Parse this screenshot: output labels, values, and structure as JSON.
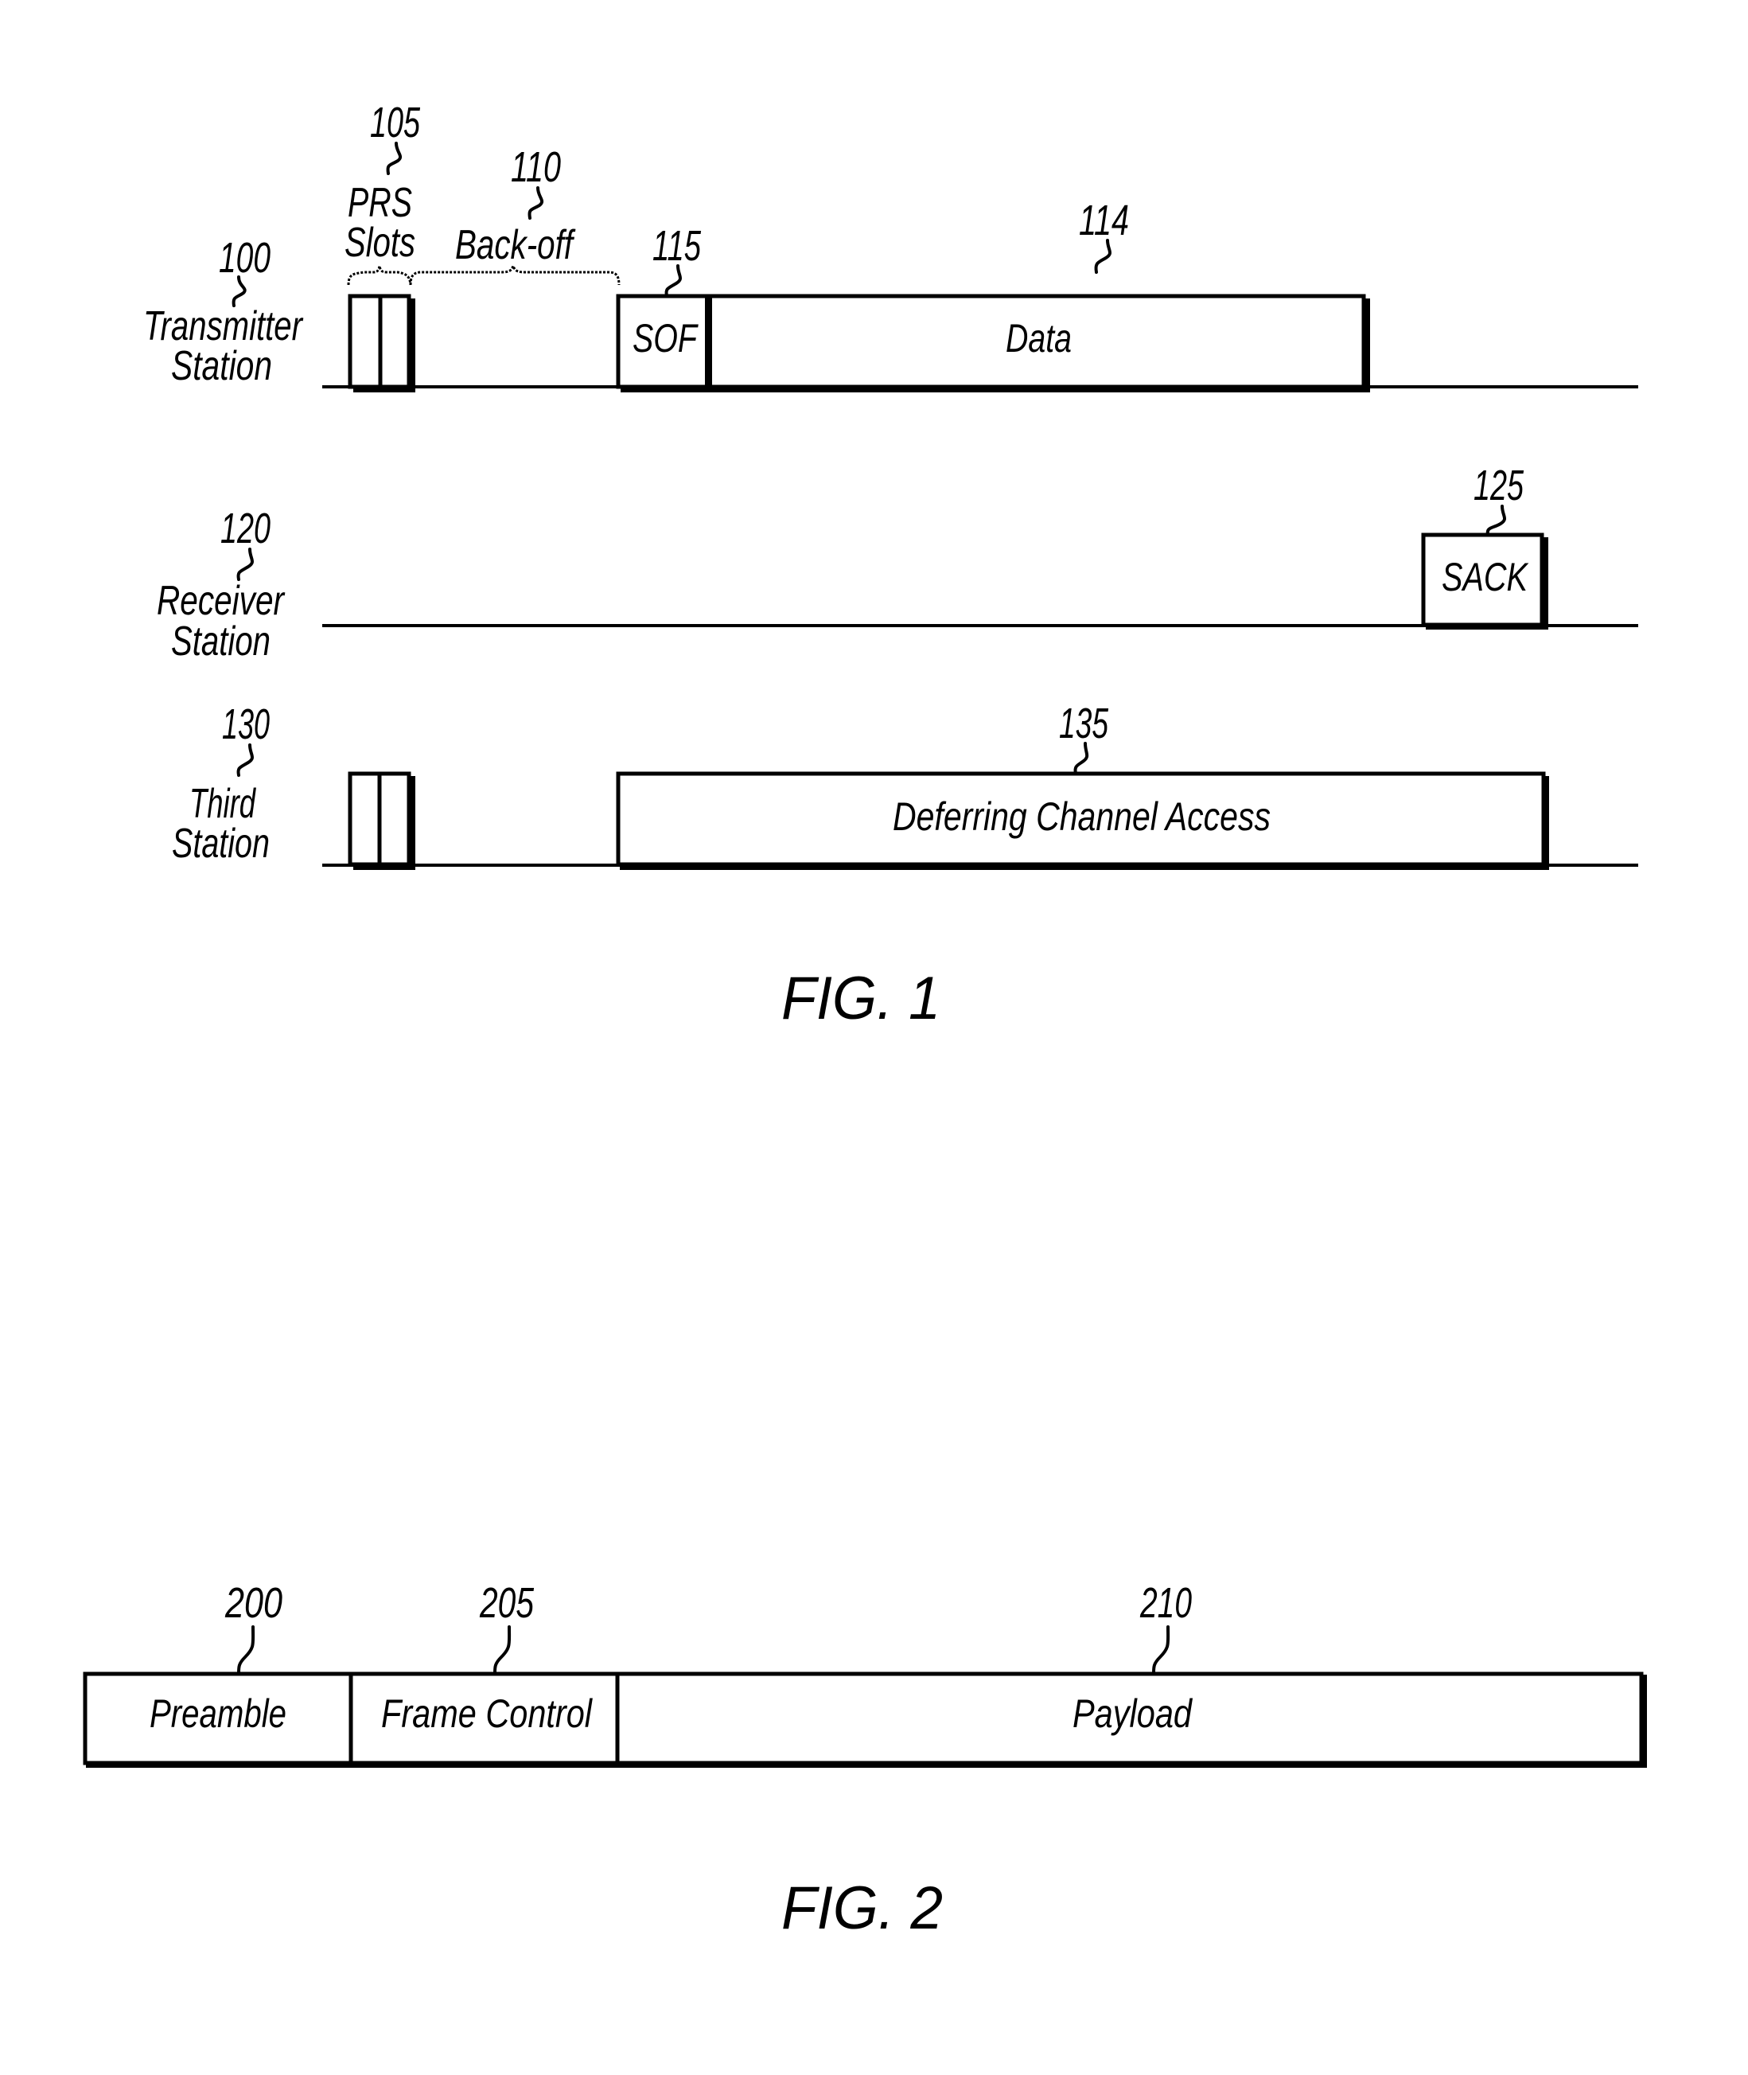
{
  "figure1": {
    "caption": "FIG. 1",
    "transmitter": {
      "ref": "100",
      "label_line1": "Transmitter",
      "label_line2": "Station",
      "prs": {
        "ref": "105",
        "label_line1": "PRS",
        "label_line2": "Slots"
      },
      "backoff": {
        "ref": "110",
        "label": "Back-off"
      },
      "sof": {
        "ref": "115",
        "label": "SOF"
      },
      "data": {
        "ref": "114",
        "label": "Data"
      }
    },
    "receiver": {
      "ref": "120",
      "label_line1": "Receiver",
      "label_line2": "Station",
      "sack": {
        "ref": "125",
        "label": "SACK"
      }
    },
    "third": {
      "ref": "130",
      "label_line1": "Third",
      "label_line2": "Station",
      "deferring": {
        "ref": "135",
        "label": "Deferring Channel Access"
      }
    }
  },
  "figure2": {
    "caption": "FIG. 2",
    "fields": [
      {
        "ref": "200",
        "label": "Preamble"
      },
      {
        "ref": "205",
        "label": "Frame Control"
      },
      {
        "ref": "210",
        "label": "Payload"
      }
    ]
  }
}
